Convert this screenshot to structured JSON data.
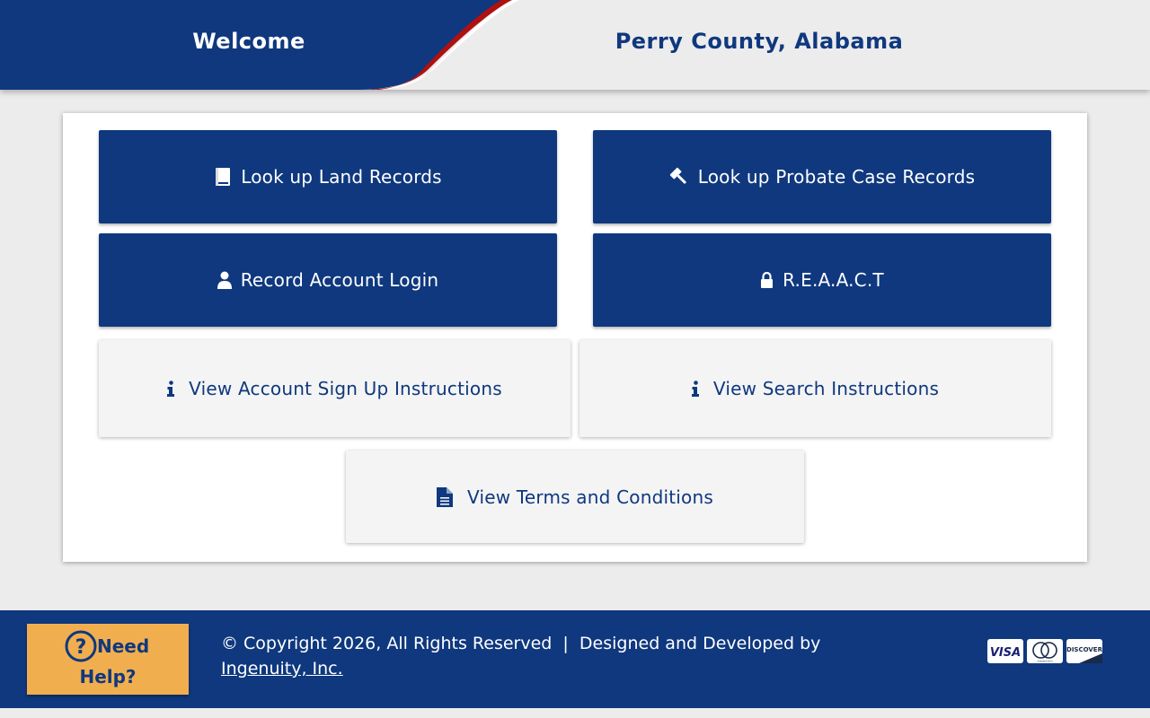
{
  "header": {
    "welcome": "Welcome",
    "county": "Perry County, Alabama"
  },
  "buttons": {
    "land_records": {
      "label": "Look up Land Records",
      "icon": "book-icon"
    },
    "probate_records": {
      "label": "Look up Probate Case Records",
      "icon": "gavel-icon"
    },
    "account_login": {
      "label": "Record Account Login",
      "icon": "user-icon"
    },
    "reaact": {
      "label": "R.E.A.A.C.T",
      "icon": "lock-icon"
    },
    "signup_instructions": {
      "label": "View Account Sign Up Instructions",
      "icon": "info-icon"
    },
    "search_instructions": {
      "label": "View Search Instructions",
      "icon": "info-icon"
    },
    "terms": {
      "label": "View Terms and Conditions",
      "icon": "document-icon"
    }
  },
  "footer": {
    "help_line1": "Need",
    "help_line2": "Help?",
    "copyright": "© Copyright 2026, All Rights Reserved  |  Designed and Developed by",
    "developer_link": "Ingenuity, Inc.",
    "payment_cards": [
      {
        "name": "VISA",
        "icon": "visa-icon"
      },
      {
        "name": "mastercard",
        "icon": "mastercard-icon"
      },
      {
        "name": "DISCOVER",
        "icon": "discover-icon"
      }
    ]
  },
  "colors": {
    "brand_blue": "#0f387e",
    "accent_red": "#b01010",
    "help_orange": "#f1ae4f",
    "background": "#ececec"
  }
}
